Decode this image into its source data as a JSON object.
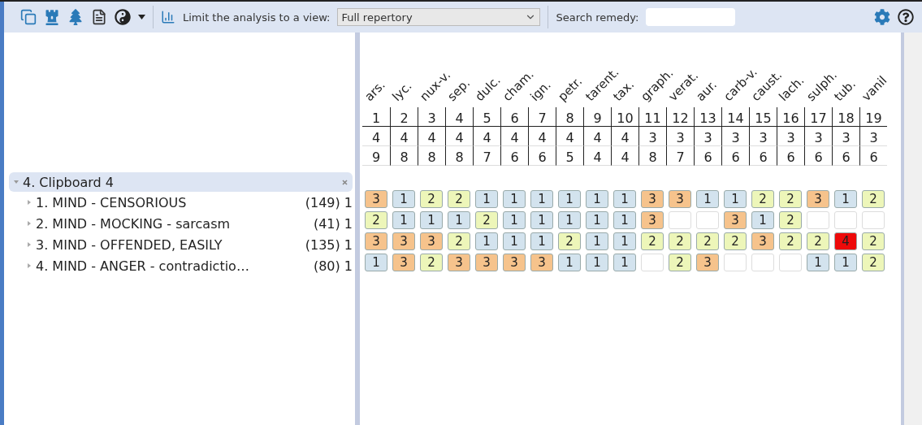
{
  "toolbar": {
    "view_label": "Limit the analysis to a view:",
    "view_value": "Full repertory",
    "search_label": "Search remedy:"
  },
  "clipboard": {
    "title": "4. Clipboard 4",
    "expanded": true,
    "rubrics": [
      {
        "label": "1. MIND - CENSORIOUS",
        "count": "(149) 1",
        "expanded": false,
        "cells": [
          "3",
          "1",
          "2",
          "2",
          "1",
          "1",
          "1",
          "1",
          "1",
          "1",
          "3",
          "3",
          "1",
          "1",
          "2",
          "2",
          "3",
          "1",
          "2"
        ]
      },
      {
        "label": "2. MIND - MOCKING - sarcasm",
        "count": "(41) 1",
        "expanded": false,
        "cells": [
          "2",
          "1",
          "1",
          "1",
          "2",
          "1",
          "1",
          "1",
          "1",
          "1",
          "3",
          null,
          null,
          "3",
          "1",
          "2",
          null,
          null,
          null
        ]
      },
      {
        "label": "3. MIND - OFFENDED, EASILY",
        "count": "(135) 1",
        "expanded": false,
        "cells": [
          "3",
          "3",
          "3",
          "2",
          "1",
          "1",
          "1",
          "2",
          "1",
          "1",
          "2",
          "2",
          "2",
          "2",
          "3",
          "2",
          "2",
          "4",
          "2"
        ]
      },
      {
        "label": "4. MIND - ANGER - contradictio…",
        "count": "(80) 1",
        "expanded": false,
        "cells": [
          "1",
          "3",
          "2",
          "3",
          "3",
          "3",
          "3",
          "1",
          "1",
          "1",
          null,
          "2",
          "3",
          null,
          null,
          null,
          "1",
          "1",
          "2"
        ]
      }
    ]
  },
  "remedies": [
    {
      "name": "ars.",
      "rank": "1",
      "score": "4",
      "hits": "9"
    },
    {
      "name": "lyc.",
      "rank": "2",
      "score": "4",
      "hits": "8"
    },
    {
      "name": "nux-v.",
      "rank": "3",
      "score": "4",
      "hits": "8"
    },
    {
      "name": "sep.",
      "rank": "4",
      "score": "4",
      "hits": "8"
    },
    {
      "name": "dulc.",
      "rank": "5",
      "score": "4",
      "hits": "7"
    },
    {
      "name": "cham.",
      "rank": "6",
      "score": "4",
      "hits": "6"
    },
    {
      "name": "ign.",
      "rank": "7",
      "score": "4",
      "hits": "6"
    },
    {
      "name": "petr.",
      "rank": "8",
      "score": "4",
      "hits": "5"
    },
    {
      "name": "tarent.",
      "rank": "9",
      "score": "4",
      "hits": "4"
    },
    {
      "name": "tax.",
      "rank": "10",
      "score": "4",
      "hits": "4"
    },
    {
      "name": "graph.",
      "rank": "11",
      "score": "3",
      "hits": "8"
    },
    {
      "name": "verat.",
      "rank": "12",
      "score": "3",
      "hits": "7"
    },
    {
      "name": "aur.",
      "rank": "13",
      "score": "3",
      "hits": "6"
    },
    {
      "name": "carb-v.",
      "rank": "14",
      "score": "3",
      "hits": "6"
    },
    {
      "name": "caust.",
      "rank": "15",
      "score": "3",
      "hits": "6"
    },
    {
      "name": "lach.",
      "rank": "16",
      "score": "3",
      "hits": "6"
    },
    {
      "name": "sulph.",
      "rank": "17",
      "score": "3",
      "hits": "6"
    },
    {
      "name": "tub.",
      "rank": "18",
      "score": "3",
      "hits": "6"
    },
    {
      "name": "vanil",
      "rank": "19",
      "score": "3",
      "hits": "6"
    }
  ]
}
